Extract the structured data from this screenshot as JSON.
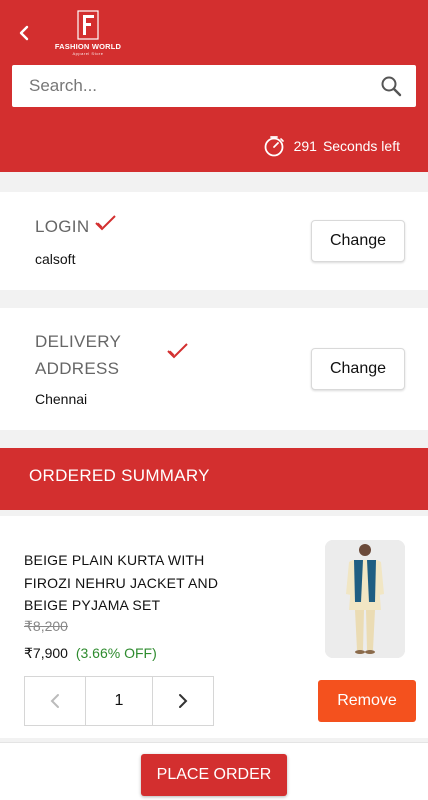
{
  "brand": {
    "name": "FASHION WORLD",
    "tagline": "Apparel Store",
    "primary_color": "#d32f2f",
    "accent_color": "#f4511e"
  },
  "search": {
    "placeholder": "Search..."
  },
  "timer": {
    "count": "291",
    "suffix": "Seconds left"
  },
  "login": {
    "title": "LOGIN",
    "value": "calsoft",
    "button": "Change"
  },
  "delivery": {
    "title_line1": "DELIVERY",
    "title_line2": "ADDRESS",
    "value": "Chennai",
    "button": "Change"
  },
  "summary": {
    "title": "ORDERED SUMMARY"
  },
  "item": {
    "name": "BEIGE PLAIN KURTA WITH FIROZI NEHRU JACKET AND BEIGE PYJAMA SET",
    "mrp": "₹8,200",
    "price": "₹7,900",
    "discount": "(3.66% OFF)",
    "quantity": "1",
    "remove_label": "Remove"
  },
  "footer": {
    "place_order": "PLACE ORDER"
  }
}
